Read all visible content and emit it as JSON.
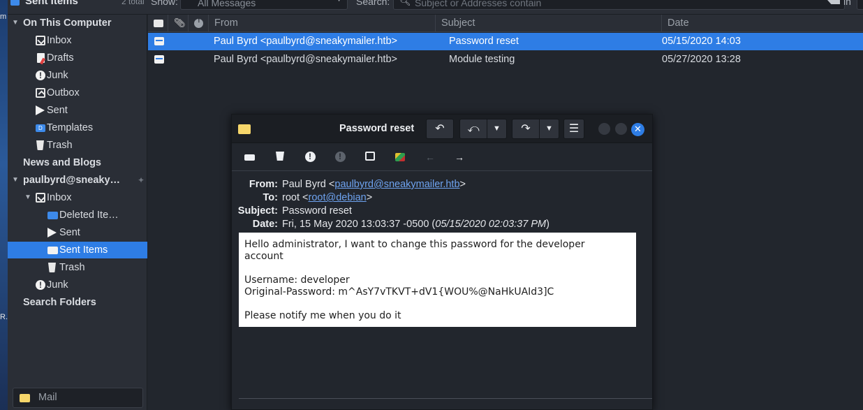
{
  "desktop": {
    "edge_text_top": "m",
    "edge_text_bottom": "R."
  },
  "header": {
    "folder_title": "Sent Items",
    "total": "2 total",
    "show_label": "Show:",
    "show_value": "All Messages",
    "search_label": "Search:",
    "search_placeholder": "Subject or Addresses contain",
    "in_label": "in"
  },
  "folders": {
    "on_this_computer": "On This Computer",
    "inbox": "Inbox",
    "drafts": "Drafts",
    "junk": "Junk",
    "outbox": "Outbox",
    "sent": "Sent",
    "templates": "Templates",
    "trash": "Trash",
    "news_blogs": "News and Blogs",
    "account": "paulbyrd@sneaky…",
    "acc_inbox": "Inbox",
    "deleted_items": "Deleted Ite…",
    "acc_sent": "Sent",
    "sent_items": "Sent Items",
    "acc_trash": "Trash",
    "acc_junk": "Junk",
    "search_folders": "Search Folders"
  },
  "switcher": {
    "mail": "Mail"
  },
  "list": {
    "columns": {
      "from": "From",
      "subject": "Subject",
      "date": "Date"
    },
    "rows": [
      {
        "from": "Paul Byrd <paulbyrd@sneakymailer.htb>",
        "subject": "Password reset",
        "date": "05/15/2020 14:03"
      },
      {
        "from": "Paul Byrd <paulbyrd@sneakymailer.htb>",
        "subject": "Module testing",
        "date": "05/27/2020 13:28"
      }
    ]
  },
  "popup": {
    "title": "Password reset",
    "headers": {
      "from_label": "From:",
      "from_name": "Paul Byrd <",
      "from_email": "paulbyrd@sneakymailer.htb",
      "from_close": ">",
      "to_label": "To:",
      "to_name": "root <",
      "to_email": "root@debian",
      "to_close": ">",
      "subject_label": "Subject:",
      "subject": "Password reset",
      "date_label": "Date:",
      "date": "Fri, 15 May 2020 13:03:37 -0500 (",
      "date_local": "05/15/2020 02:03:37 PM",
      "date_close": ")"
    },
    "body": {
      "line1": "Hello administrator, I want to change this password for the developer",
      "line2": "account",
      "line3": "Username: developer",
      "line4": "Original-Password: m^AsY7vTKVT+dV1{WOU%@NaHkUAId3]C",
      "line5": "Please notify me when you do it"
    }
  },
  "colors": {
    "accent": "#2e7de5",
    "background": "#22262d",
    "panel": "#2a2e36",
    "link": "#6ea3f0"
  }
}
